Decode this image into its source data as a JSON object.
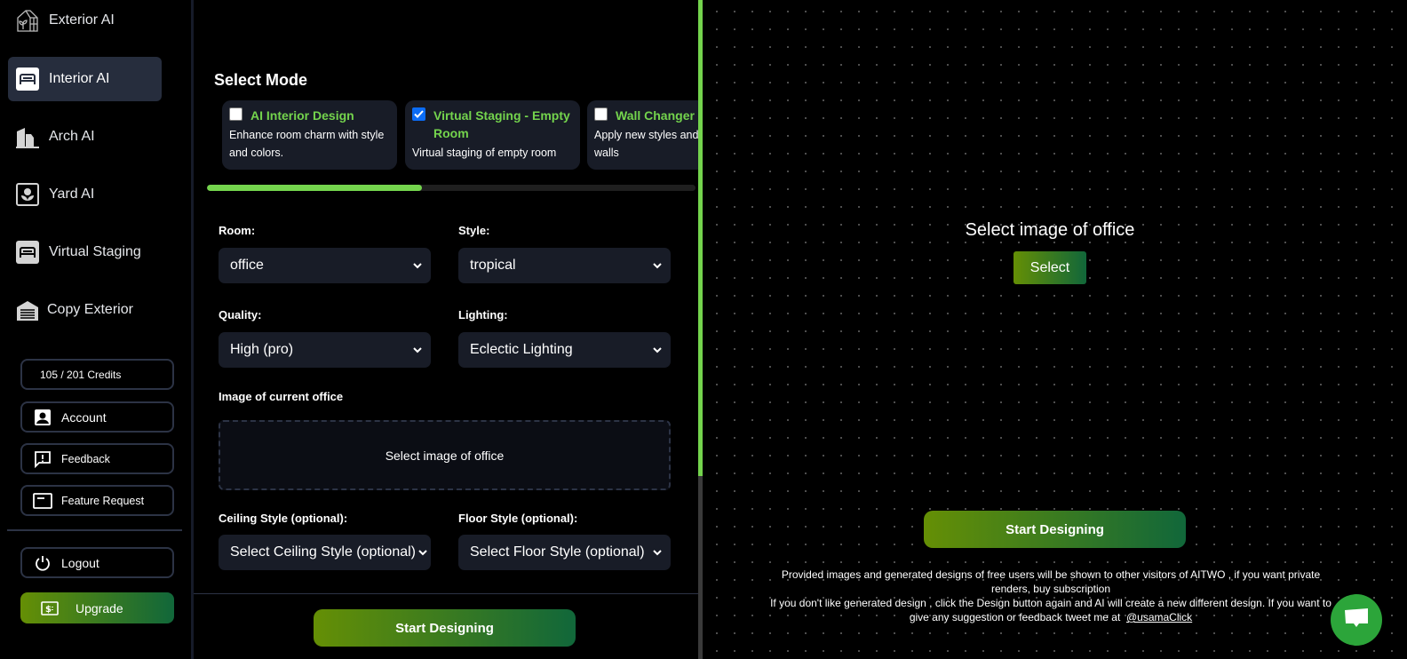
{
  "sidebar": {
    "nav": [
      {
        "label": "Exterior AI",
        "icon": "greenhouse-icon",
        "active": false
      },
      {
        "label": "Interior AI",
        "icon": "bed-icon",
        "active": true
      },
      {
        "label": "Arch AI",
        "icon": "buildings-icon",
        "active": false
      },
      {
        "label": "Yard AI",
        "icon": "flower-icon",
        "active": false
      },
      {
        "label": "Virtual Staging",
        "icon": "bed-icon",
        "active": false
      },
      {
        "label": "Copy Exterior",
        "icon": "garage-icon",
        "active": false
      }
    ],
    "credits": "105 / 201 Credits",
    "account": "Account",
    "feedback": "Feedback",
    "feature_request": "Feature Request",
    "logout": "Logout",
    "upgrade": "Upgrade"
  },
  "form": {
    "mode_title": "Select Mode",
    "modes": [
      {
        "title": "AI Interior Design",
        "description": "Enhance room charm with style and colors.",
        "checked": false
      },
      {
        "title": "Virtual Staging - Empty Room",
        "description": "Virtual staging of empty room",
        "checked": true
      },
      {
        "title": "Wall Changer",
        "description": "Apply new styles and colors to walls",
        "checked": false
      }
    ],
    "mode_scroll_progress": 0.44,
    "room": {
      "label": "Room:",
      "value": "office"
    },
    "style": {
      "label": "Style:",
      "value": "tropical"
    },
    "quality": {
      "label": "Quality:",
      "value": "High (pro)"
    },
    "lighting": {
      "label": "Lighting:",
      "value": "Eclectic Lighting"
    },
    "image_label": "Image of current office",
    "dropzone_text": "Select image of office",
    "ceiling": {
      "label": "Ceiling Style (optional):",
      "value": "Select Ceiling Style (optional)"
    },
    "floor": {
      "label": "Floor Style (optional):",
      "value": "Select Floor Style (optional)"
    },
    "start_button": "Start Designing"
  },
  "preview": {
    "title": "Select image of office",
    "select_button": "Select",
    "start_button": "Start Designing",
    "notice_line1": "Provided images and generated designs of free users will be shown to other visitors of AITWO , if you want private renders, buy subscription",
    "notice_line2": "If you don't like generated design , click the Design button again and AI will create a new different design. If you want to give any suggestion or feedback tweet me at",
    "twitter_handle": "@usamaClick"
  },
  "colors": {
    "accent_green": "#74d44d",
    "gradient_start": "#658f05",
    "gradient_end": "#11673a",
    "card_bg": "#181c27",
    "chat_green": "#2ca53a"
  }
}
